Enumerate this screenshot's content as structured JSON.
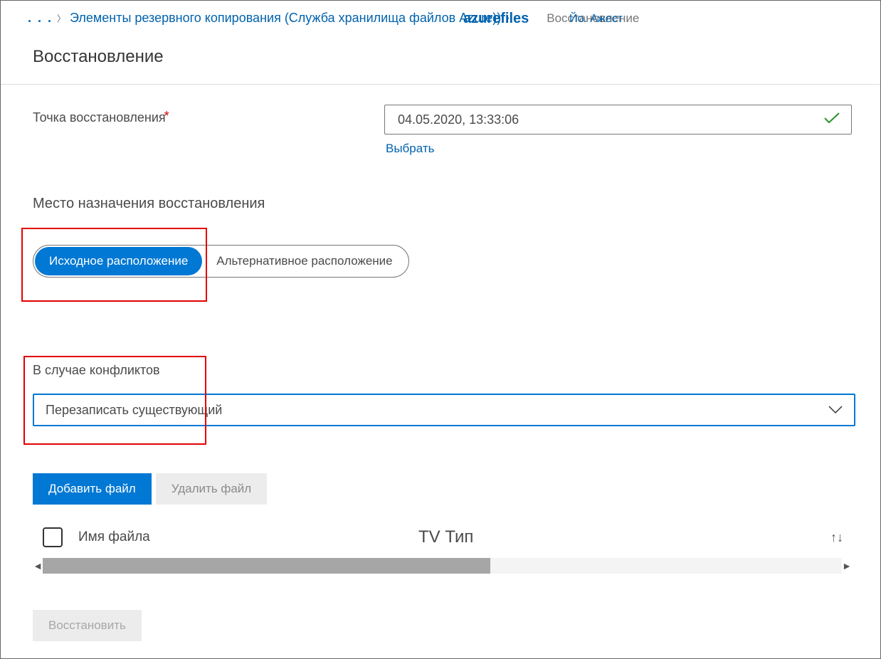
{
  "breadcrumb": {
    "ellipsis": ". . .",
    "item1": "Элементы резервного копирования (Служба хранилища файлов Azure))",
    "item2_overlay": "azurefiles",
    "item3_overlay": "Йо. Ажест",
    "current": "Восстановление"
  },
  "page_title": "Восстановление",
  "restore_point": {
    "label": "Точка восстановления",
    "value": "04.05.2020, 13:33:06",
    "select_link": "Выбрать"
  },
  "destination": {
    "label": "Место назначения восстановления",
    "option_original": "Исходное расположение",
    "option_alternate": "Альтернативное расположение"
  },
  "conflicts": {
    "label": "В случае конфликтов",
    "selected": "Перезаписать существующий"
  },
  "buttons": {
    "add_file": "Добавить файл",
    "delete_file": "Удалить файл",
    "restore": "Восстановить"
  },
  "table": {
    "col_name": "Имя файла",
    "col_type": "TV Тип",
    "sort_glyph": "↑↓"
  }
}
